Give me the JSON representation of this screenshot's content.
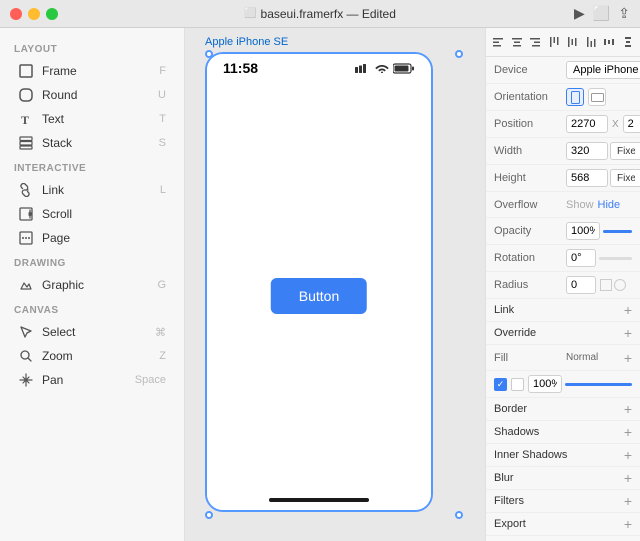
{
  "titlebar": {
    "filename": "baseui.framerfx",
    "status": "Edited",
    "title_text": "baseui.framerfx — Edited"
  },
  "sidebar": {
    "sections": [
      {
        "label": "Layout",
        "items": [
          {
            "icon": "frame-icon",
            "label": "Frame",
            "shortcut": "F"
          },
          {
            "icon": "round-icon",
            "label": "Round",
            "shortcut": "U"
          },
          {
            "icon": "text-icon",
            "label": "Text",
            "shortcut": "T"
          },
          {
            "icon": "stack-icon",
            "label": "Stack",
            "shortcut": "S"
          }
        ]
      },
      {
        "label": "Interactive",
        "items": [
          {
            "icon": "link-icon",
            "label": "Link",
            "shortcut": "L"
          },
          {
            "icon": "scroll-icon",
            "label": "Scroll",
            "shortcut": ""
          },
          {
            "icon": "page-icon",
            "label": "Page",
            "shortcut": ""
          }
        ]
      },
      {
        "label": "Drawing",
        "items": [
          {
            "icon": "graphic-icon",
            "label": "Graphic",
            "shortcut": "G"
          }
        ]
      },
      {
        "label": "Canvas",
        "items": [
          {
            "icon": "select-icon",
            "label": "Select",
            "shortcut": "⌘"
          },
          {
            "icon": "zoom-icon",
            "label": "Zoom",
            "shortcut": "Z"
          },
          {
            "icon": "pan-icon",
            "label": "Pan",
            "shortcut": "Space"
          }
        ]
      }
    ]
  },
  "canvas": {
    "device_label": "Apple iPhone SE",
    "phone_time": "11:58",
    "button_label": "Button"
  },
  "right_panel": {
    "toolbar": {
      "icons": [
        "align-left",
        "align-center",
        "align-right",
        "align-top",
        "align-middle",
        "align-bottom",
        "distribute-h",
        "distribute-v"
      ]
    },
    "properties": {
      "device": {
        "label": "Device",
        "value": "Apple iPhone SE"
      },
      "orientation": {
        "label": "Orientation"
      },
      "position": {
        "label": "Position",
        "x": "2270",
        "y": "2"
      },
      "width": {
        "label": "Width",
        "value": "320",
        "mode": "Fixed"
      },
      "height": {
        "label": "Height",
        "value": "568",
        "mode": "Fixed"
      },
      "overflow": {
        "label": "Overflow",
        "show": "Show",
        "hide": "Hide"
      },
      "opacity": {
        "label": "Opacity",
        "value": "100%",
        "percent": 100
      },
      "rotation": {
        "label": "Rotation",
        "value": "0°"
      },
      "radius": {
        "label": "Radius",
        "value": "0"
      },
      "link": {
        "label": "Link"
      },
      "override": {
        "label": "Override"
      },
      "fill": {
        "label": "Fill",
        "mode": "Normal",
        "opacity_value": "100%"
      },
      "border": {
        "label": "Border"
      },
      "shadows": {
        "label": "Shadows"
      },
      "inner_shadows": {
        "label": "Inner Shadows"
      },
      "blur": {
        "label": "Blur"
      },
      "filters": {
        "label": "Filters"
      },
      "export": {
        "label": "Export"
      }
    }
  }
}
